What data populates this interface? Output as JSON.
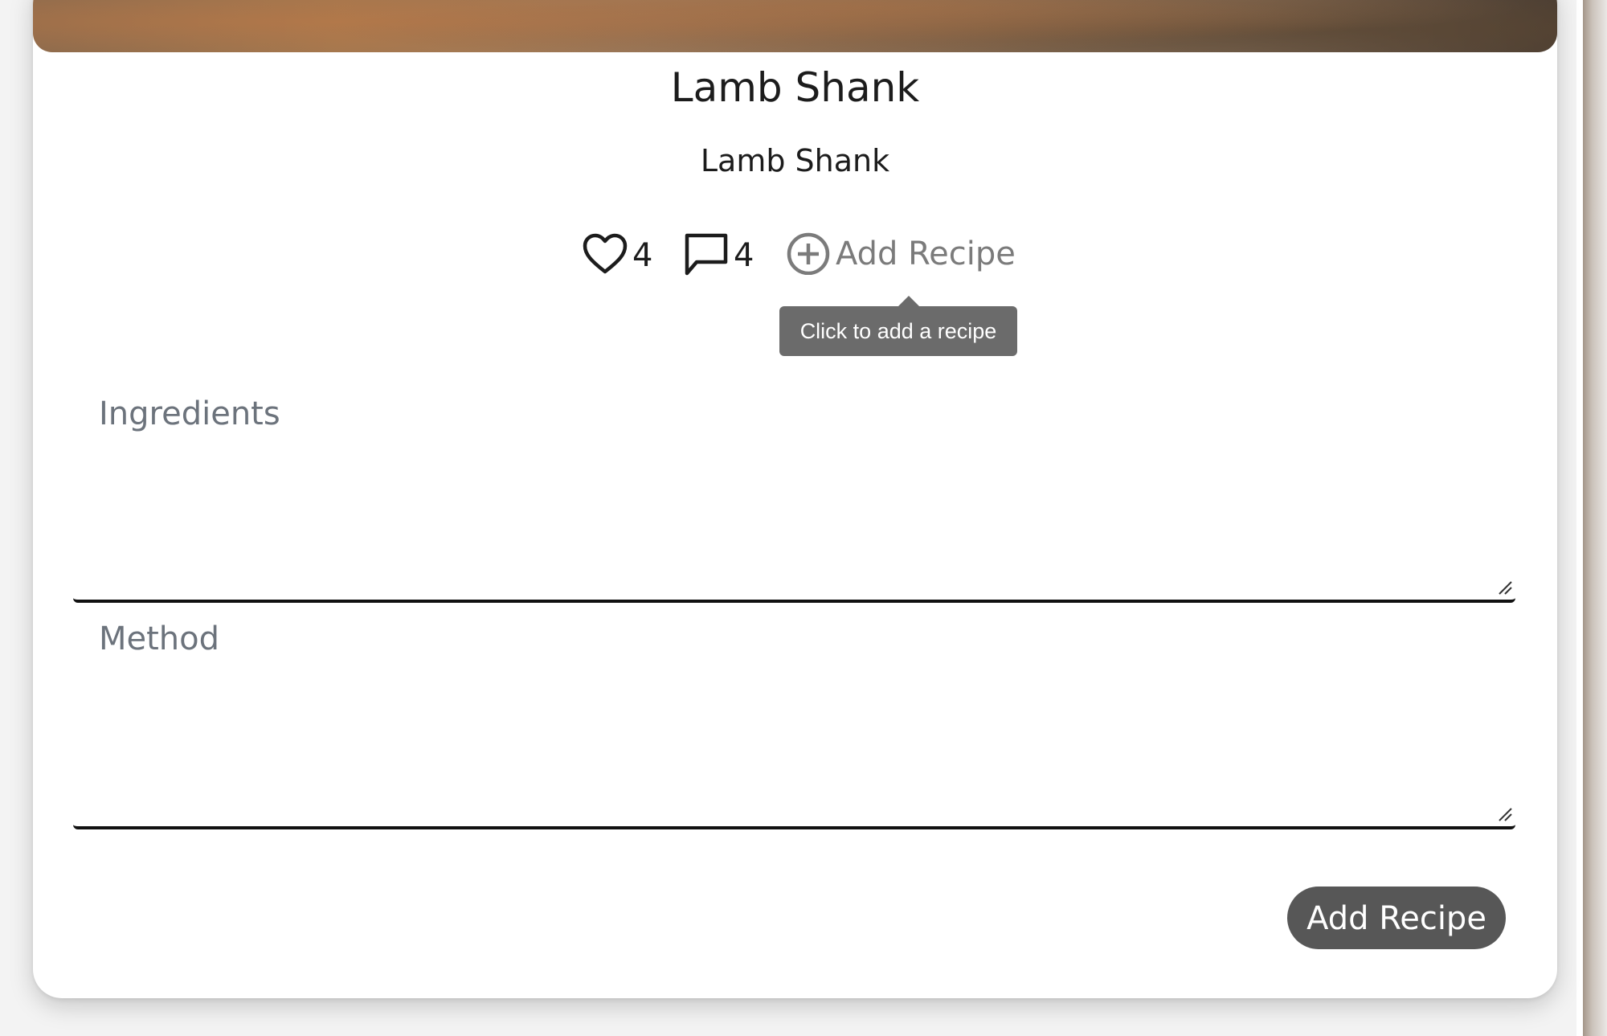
{
  "recipe": {
    "title": "Lamb Shank",
    "subtitle": "Lamb Shank",
    "likes": "4",
    "comments": "4",
    "add_link_label": "Add Recipe",
    "tooltip": "Click to add a recipe"
  },
  "form": {
    "ingredients_label": "Ingredients",
    "method_label": "Method",
    "submit_label": "Add Recipe"
  },
  "icons": {
    "like": "heart-icon",
    "comment": "comment-icon",
    "add": "plus-circle-icon"
  },
  "colors": {
    "button_bg": "#575757",
    "tooltip_bg": "#6b6b6b",
    "label_text": "#6c737c"
  }
}
